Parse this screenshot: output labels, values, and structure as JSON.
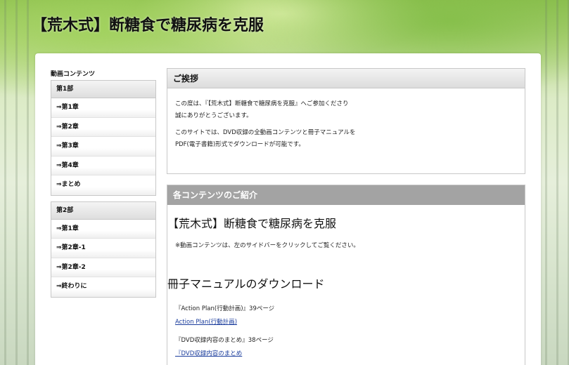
{
  "header": {
    "site_title": "【荒木式】断糖食で糖尿病を克服"
  },
  "sidebar": {
    "heading": "動画コンテンツ",
    "groups": [
      {
        "title": "第1部",
        "items": [
          "⇒第1章",
          "⇒第2章",
          "⇒第3章",
          "⇒第4章",
          "⇒まとめ"
        ]
      },
      {
        "title": "第2部",
        "items": [
          "⇒第1章",
          "⇒第2章-1",
          "⇒第2章-2",
          "⇒終わりに"
        ]
      }
    ]
  },
  "greeting": {
    "title": "ご挨拶",
    "line1": "この度は、『【荒木式】断糖食で糖尿病を克服』へご参加くださり",
    "line2": "誠にありがとうございます。",
    "line3": "このサイトでは、DVD収録の全動画コンテンツと冊子マニュアルを",
    "line4": "PDF(電子書籍)形式でダウンロードが可能です。"
  },
  "contents": {
    "title": "各コンテンツのご紹介",
    "heading1": "【荒木式】断糖食で糖尿病を克服",
    "note": "※動画コンテンツは、左のサイドバーをクリックしてご覧ください。",
    "heading2": "冊子マニュアルのダウンロード",
    "downloads": [
      {
        "label": "『Action Plan(行動計画)』39ページ",
        "link": "Action Plan(行動計画)"
      },
      {
        "label": "『DVD収録内容のまとめ』38ページ",
        "link": "『DVD収録内容のまとめ"
      }
    ]
  },
  "colors": {
    "link": "#1a3c9c",
    "dark_panel_header": "#a3a3a3"
  }
}
